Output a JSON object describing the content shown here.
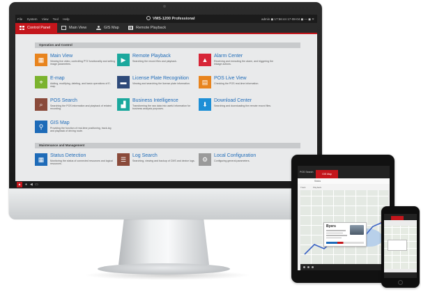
{
  "desktop": {
    "menu": [
      "File",
      "System",
      "View",
      "Tool",
      "Help"
    ],
    "app_title": "VMS-1200 Professional",
    "status_right": "admin  ◼  17:56:44  17-08-04  ◼  —  ◼  ✕",
    "tabs": [
      {
        "label": "Control Panel",
        "icon": "grid-icon"
      },
      {
        "label": "Main View",
        "icon": "monitor-icon"
      },
      {
        "label": "GIS Map",
        "icon": "user-icon"
      },
      {
        "label": "Remote Playback",
        "icon": "film-icon"
      }
    ],
    "sections": {
      "operation": "Operation and Control",
      "maintenance": "Maintenance and Management"
    },
    "modules": [
      {
        "title": "Main View",
        "desc": "Viewing live video, controlling PTZ functionality and setting image parameters.",
        "color": "#e8841e",
        "icon": "grid-icon"
      },
      {
        "title": "Remote Playback",
        "desc": "Searching the record files and playback.",
        "color": "#1ba89d",
        "icon": "playback-icon"
      },
      {
        "title": "Alarm Center",
        "desc": "Receiving and executing the alarm, and triggering the linkage actions.",
        "color": "#d72638",
        "icon": "alarm-icon"
      },
      {
        "title": "E-map",
        "desc": "Adding, modifying, deleting, and basic operations of E-map.",
        "color": "#7bb32e",
        "icon": "emap-icon"
      },
      {
        "title": "License Plate Recognition",
        "desc": "Viewing and searching the license plate information.",
        "color": "#2e4a7a",
        "icon": "car-icon"
      },
      {
        "title": "POS Live View",
        "desc": "Checking the POS real-time information.",
        "color": "#e8841e",
        "icon": "pos-icon"
      },
      {
        "title": "POS Search",
        "desc": "Searching the POS information and playback of related recording.",
        "color": "#8a4a3a",
        "icon": "pos-search-icon"
      },
      {
        "title": "Business Intelligence",
        "desc": "Transforming the raw data into useful information for business analysis purposes.",
        "color": "#1ba89d",
        "icon": "chart-icon"
      },
      {
        "title": "Download Center",
        "desc": "Searching and downloading the remote record files.",
        "color": "#1e8fd6",
        "icon": "download-icon"
      },
      {
        "title": "GIS Map",
        "desc": "Providing the function of real-time positioning, track-log and playback of driving route.",
        "color": "#1e6bb8",
        "icon": "map-pin-icon"
      }
    ],
    "maintenance_modules": [
      {
        "title": "Status Detection",
        "desc": "Monitoring the status of connected resources and logical resources.",
        "color": "#1e6bb8",
        "icon": "status-icon"
      },
      {
        "title": "Log Search",
        "desc": "Searching, viewing and backup of CMS and device logs.",
        "color": "#8a4a3a",
        "icon": "log-icon"
      },
      {
        "title": "Local Configuration",
        "desc": "Configuring general parameters.",
        "color": "#9a9a9a",
        "icon": "config-icon"
      }
    ]
  },
  "tablet": {
    "tab_left": "POS Search",
    "tab_active": "GIS Map",
    "sub_label": "Status",
    "tools": [
      "Track",
      "Playback"
    ],
    "popup_title": "Byers"
  }
}
